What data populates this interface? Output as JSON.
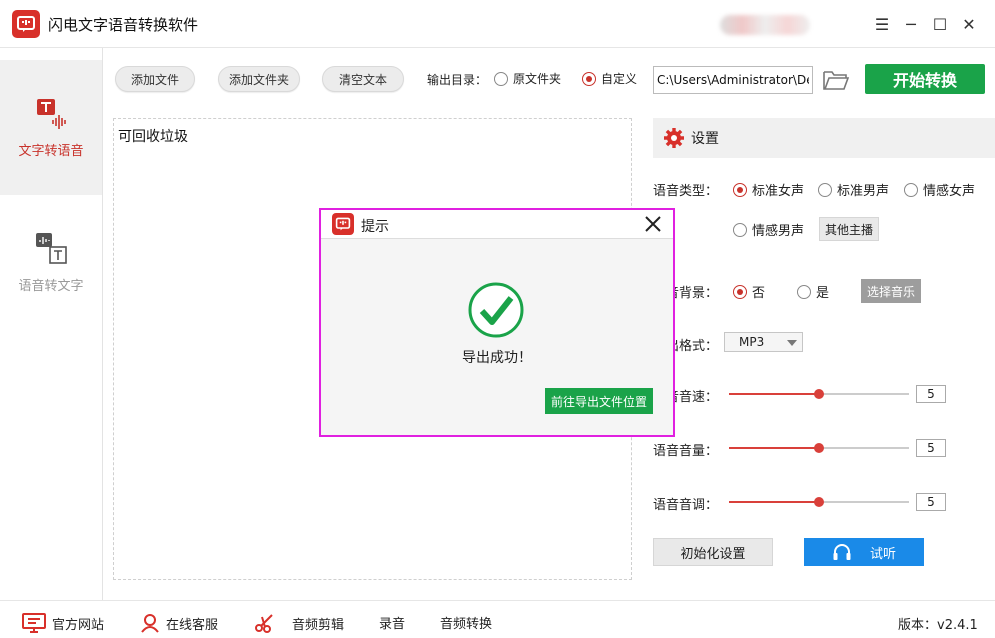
{
  "app": {
    "title": "闪电文字语音转换软件"
  },
  "window_controls": {
    "menu": "☰",
    "minimize": "─",
    "maximize": "☐",
    "close": "✕"
  },
  "sidebar": {
    "items": [
      {
        "label": "文字转语音",
        "active": true
      },
      {
        "label": "语音转文字",
        "active": false
      }
    ]
  },
  "toolbar": {
    "add_file": "添加文件",
    "add_folder": "添加文件夹",
    "clear_text": "清空文本",
    "output_label": "输出目录：",
    "output_options": [
      "原文件夹",
      "自定义"
    ],
    "output_selected": "自定义",
    "output_path": "C:\\Users\\Administrator\\De",
    "start": "开始转换"
  },
  "editor": {
    "content": "可回收垃圾"
  },
  "settings": {
    "title": "设置",
    "voice_type_label": "语音类型：",
    "voices": [
      "标准女声",
      "标准男声",
      "情感女声",
      "情感男声"
    ],
    "voice_selected": "标准女声",
    "other_anchor": "其他主播",
    "bg_label": "音背景：",
    "bg_options": [
      "否",
      "是"
    ],
    "bg_selected": "否",
    "select_music": "选择音乐",
    "format_label": "出格式：",
    "format_value": "MP3",
    "speed_label": "音音速：",
    "speed_value": "5",
    "volume_label": "语音音量：",
    "volume_value": "5",
    "pitch_label": "语音音调：",
    "pitch_value": "5",
    "slider_fraction": 0.5,
    "reset": "初始化设置",
    "listen": "试听"
  },
  "dialog": {
    "title": "提示",
    "message": "导出成功！",
    "open_location": "前往导出文件位置"
  },
  "footer": {
    "items": [
      "官方网站",
      "在线客服",
      "音频剪辑",
      "录音",
      "音频转换"
    ],
    "version": "版本：v2.4.1"
  },
  "colors": {
    "accent": "#c8322b",
    "green": "#1aa349",
    "blue": "#1a8ae8",
    "highlight": "#e020e0"
  }
}
